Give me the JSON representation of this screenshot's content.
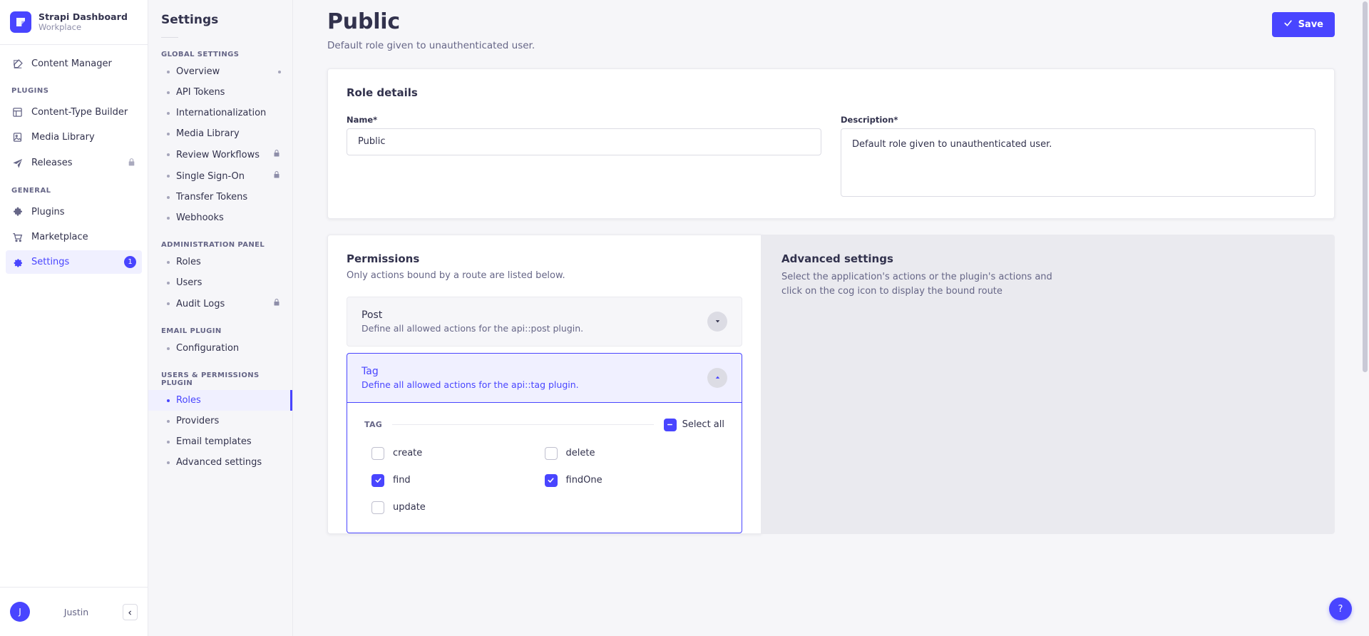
{
  "brand": {
    "title": "Strapi Dashboard",
    "subtitle": "Workplace",
    "logo_icon": "strapi-logo-icon"
  },
  "sidebar": {
    "primary": [
      {
        "label": "Content Manager",
        "icon": "pencil-square-icon",
        "locked": false,
        "active": false
      }
    ],
    "groups": [
      {
        "label": "PLUGINS",
        "items": [
          {
            "label": "Content-Type Builder",
            "icon": "layout-grid-icon",
            "locked": false,
            "active": false
          },
          {
            "label": "Media Library",
            "icon": "image-icon",
            "locked": false,
            "active": false
          },
          {
            "label": "Releases",
            "icon": "paper-plane-icon",
            "locked": true,
            "active": false
          }
        ]
      },
      {
        "label": "GENERAL",
        "items": [
          {
            "label": "Plugins",
            "icon": "puzzle-piece-icon",
            "locked": false,
            "active": false
          },
          {
            "label": "Marketplace",
            "icon": "shopping-cart-icon",
            "locked": false,
            "active": false
          },
          {
            "label": "Settings",
            "icon": "gear-icon",
            "locked": false,
            "active": true,
            "badge": "1"
          }
        ]
      }
    ],
    "user": {
      "initial": "J",
      "name": "Justin",
      "collapse_icon": "chevron-left-icon"
    }
  },
  "subnav": {
    "title": "Settings",
    "groups": [
      {
        "label": "GLOBAL SETTINGS",
        "items": [
          {
            "label": "Overview",
            "locked": false,
            "active": false,
            "trailing_dot": true
          },
          {
            "label": "API Tokens",
            "locked": false,
            "active": false
          },
          {
            "label": "Internationalization",
            "locked": false,
            "active": false
          },
          {
            "label": "Media Library",
            "locked": false,
            "active": false
          },
          {
            "label": "Review Workflows",
            "locked": true,
            "active": false
          },
          {
            "label": "Single Sign-On",
            "locked": true,
            "active": false
          },
          {
            "label": "Transfer Tokens",
            "locked": false,
            "active": false
          },
          {
            "label": "Webhooks",
            "locked": false,
            "active": false
          }
        ]
      },
      {
        "label": "ADMINISTRATION PANEL",
        "items": [
          {
            "label": "Roles",
            "locked": false,
            "active": false
          },
          {
            "label": "Users",
            "locked": false,
            "active": false
          },
          {
            "label": "Audit Logs",
            "locked": true,
            "active": false
          }
        ]
      },
      {
        "label": "EMAIL PLUGIN",
        "items": [
          {
            "label": "Configuration",
            "locked": false,
            "active": false
          }
        ]
      },
      {
        "label": "USERS & PERMISSIONS PLUGIN",
        "items": [
          {
            "label": "Roles",
            "locked": false,
            "active": true
          },
          {
            "label": "Providers",
            "locked": false,
            "active": false
          },
          {
            "label": "Email templates",
            "locked": false,
            "active": false
          },
          {
            "label": "Advanced settings",
            "locked": false,
            "active": false
          }
        ]
      }
    ]
  },
  "header": {
    "title": "Public",
    "subtitle": "Default role given to unauthenticated user.",
    "save_label": "Save",
    "save_icon": "check-icon"
  },
  "role_details": {
    "heading": "Role details",
    "name_label": "Name*",
    "name_value": "Public",
    "description_label": "Description*",
    "description_value": "Default role given to unauthenticated user."
  },
  "permissions": {
    "heading": "Permissions",
    "description": "Only actions bound by a route are listed below.",
    "accordions": [
      {
        "title": "Post",
        "subtitle": "Define all allowed actions for the api::post plugin.",
        "expanded": false,
        "toggle_icon": "chevron-down-icon"
      },
      {
        "title": "Tag",
        "subtitle": "Define all allowed actions for the api::tag plugin.",
        "expanded": true,
        "toggle_icon": "chevron-up-icon",
        "section_label": "TAG",
        "select_all_label": "Select all",
        "select_all_state": "indeterminate",
        "actions": [
          {
            "name": "create",
            "checked": false
          },
          {
            "name": "delete",
            "checked": false
          },
          {
            "name": "find",
            "checked": true
          },
          {
            "name": "findOne",
            "checked": true
          },
          {
            "name": "update",
            "checked": false
          }
        ]
      }
    ]
  },
  "advanced": {
    "title": "Advanced settings",
    "description": "Select the application's actions or the plugin's actions and click on the cog icon to display the bound route"
  },
  "help": {
    "label": "?",
    "icon": "question-mark-icon"
  },
  "colors": {
    "accent": "#4945ff",
    "accent_soft": "#f0f0ff",
    "page_bg": "#f6f6f9",
    "text": "#32324d",
    "text_muted": "#666687",
    "border": "#eaeaef"
  }
}
